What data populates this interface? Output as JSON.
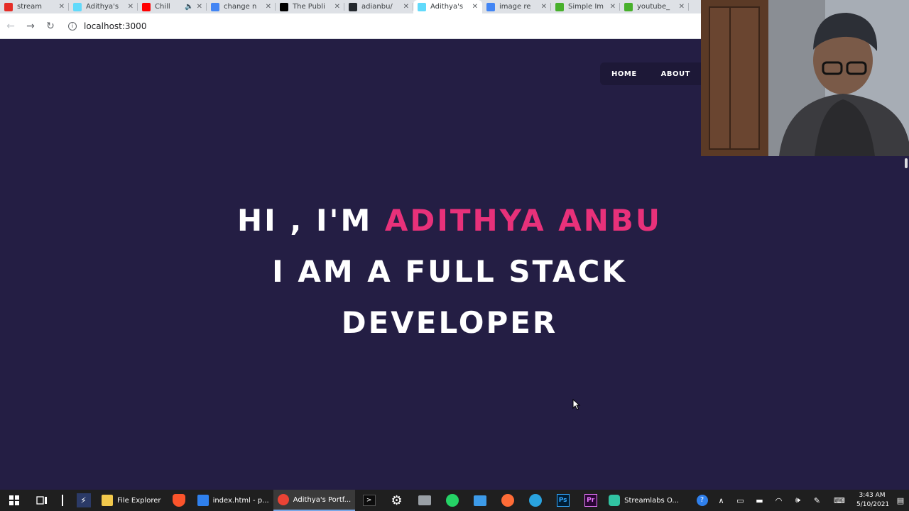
{
  "browser": {
    "tabs": [
      {
        "title": "stream",
        "favicon_color": "#e52d27",
        "favicon_name": "stream-favicon-icon"
      },
      {
        "title": "Adithya's",
        "favicon_color": "#61dafb",
        "favicon_name": "react-favicon-icon"
      },
      {
        "title": "Chill",
        "favicon_color": "#ff0000",
        "favicon_name": "youtube-favicon-icon",
        "muted_icon": "🔈"
      },
      {
        "title": "change n",
        "favicon_color": "#4285f4",
        "favicon_name": "google-favicon-icon"
      },
      {
        "title": "The Publi",
        "favicon_color": "#000000",
        "favicon_name": "medium-favicon-icon"
      },
      {
        "title": "adianbu/",
        "favicon_color": "#24292e",
        "favicon_name": "github-favicon-icon"
      },
      {
        "title": "Adithya's",
        "favicon_color": "#61dafb",
        "favicon_name": "react-favicon-icon",
        "active": true
      },
      {
        "title": "image re",
        "favicon_color": "#4285f4",
        "favicon_name": "google-favicon-icon"
      },
      {
        "title": "Simple Im",
        "favicon_color": "#48b02c",
        "favicon_name": "gear-favicon-icon"
      },
      {
        "title": "youtube_",
        "favicon_color": "#48b02c",
        "favicon_name": "gear-favicon-icon"
      }
    ],
    "close_glyph": "✕",
    "address": "localhost:3000",
    "info_glyph": "i",
    "back_glyph": "←",
    "forward_glyph": "→",
    "reload_glyph": "↻"
  },
  "site": {
    "nav": {
      "home": "HOME",
      "about": "ABOUT"
    },
    "hero": {
      "line1_prefix": "HI , I'M ",
      "line1_name": "ADITHYA ANBU",
      "line2": "I AM A FULL STACK",
      "line3": "DEVELOPER"
    },
    "colors": {
      "background": "#241e44",
      "accent": "#e8317a",
      "text": "#ffffff"
    }
  },
  "taskbar": {
    "apps": [
      {
        "label": "File Explorer",
        "icon_color": "#f2c94c",
        "icon_name": "folder-icon"
      },
      {
        "label": "index.html - p...",
        "icon_color": "#2f80ed",
        "icon_name": "vscode-icon"
      },
      {
        "label": "Adithya's Portf...",
        "icon_color": "#ea4335",
        "icon_name": "chrome-icon",
        "active": true
      },
      {
        "label": "Streamlabs O...",
        "icon_color": "#31c3a2",
        "icon_name": "streamlabs-icon"
      }
    ],
    "time": "3:43 AM",
    "date": "5/10/2021"
  }
}
